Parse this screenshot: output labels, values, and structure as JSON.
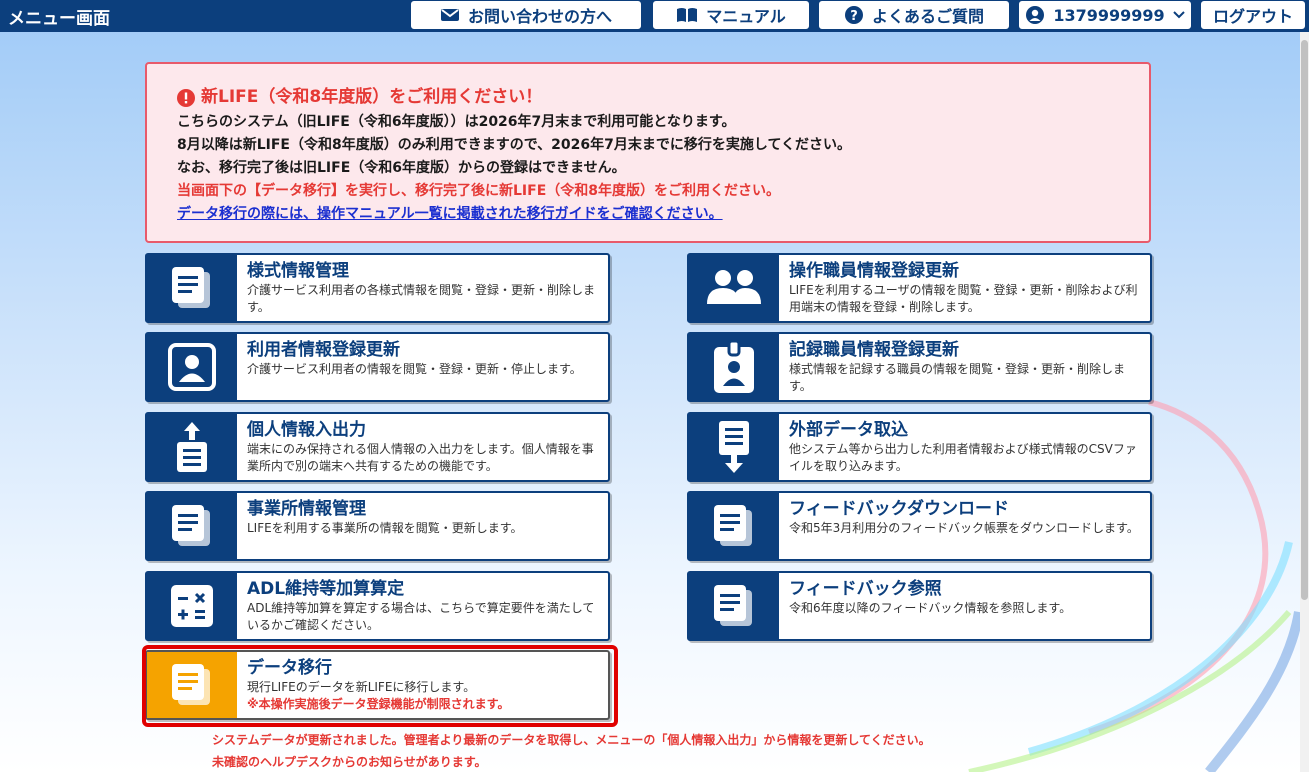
{
  "header": {
    "title": "メニュー画面",
    "contact": "お問い合わせの方へ",
    "manual": "マニュアル",
    "faq": "よくあるご質問",
    "user": "1379999999",
    "logout": "ログアウト"
  },
  "notice": {
    "title": "新LIFE（令和8年度版）をご利用ください！",
    "line1": "こちらのシステム（旧LIFE（令和6年度版））は2026年7月末まで利用可能となります。",
    "line2": "8月以降は新LIFE（令和8年度版）のみ利用できますので、2026年7月末までに移行を実施してください。",
    "line3": "なお、移行完了後は旧LIFE（令和6年度版）からの登録はできません。",
    "line4": "当画面下の【データ移行】を実行し、移行完了後に新LIFE（令和8年度版）をご利用ください。",
    "link": "データ移行の際には、操作マニュアル一覧に掲載された移行ガイドをご確認ください。"
  },
  "menu": {
    "form_info": {
      "title": "様式情報管理",
      "desc": "介護サービス利用者の各様式情報を閲覧・登録・更新・削除します。"
    },
    "operator": {
      "title": "操作職員情報登録更新",
      "desc": "LIFEを利用するユーザの情報を閲覧・登録・更新・削除および利用端末の情報を登録・削除します。"
    },
    "user_info": {
      "title": "利用者情報登録更新",
      "desc": "介護サービス利用者の情報を閲覧・登録・更新・停止します。"
    },
    "recorder": {
      "title": "記録職員情報登録更新",
      "desc": "様式情報を記録する職員の情報を閲覧・登録・更新・削除します。"
    },
    "personal_io": {
      "title": "個人情報入出力",
      "desc": "端末にのみ保持される個人情報の入出力をします。個人情報を事業所内で別の端末へ共有するための機能です。"
    },
    "external": {
      "title": "外部データ取込",
      "desc": "他システム等から出力した利用者情報および様式情報のCSVファイルを取り込みます。"
    },
    "office": {
      "title": "事業所情報管理",
      "desc": "LIFEを利用する事業所の情報を閲覧・更新します。"
    },
    "fb_download": {
      "title": "フィードバックダウンロード",
      "desc": "令和5年3月利用分のフィードバック帳票をダウンロードします。"
    },
    "adl": {
      "title": "ADL維持等加算算定",
      "desc": "ADL維持等加算を算定する場合は、こちらで算定要件を満たしているかご確認ください。"
    },
    "fb_view": {
      "title": "フィードバック参照",
      "desc": "令和6年度以降のフィードバック情報を参照します。"
    },
    "migrate": {
      "title": "データ移行",
      "desc": "現行LIFEのデータを新LIFEに移行します。",
      "warn": "※本操作実施後データ登録機能が制限されます。"
    }
  },
  "messages": {
    "update": "システムデータが更新されました。管理者より最新のデータを取得し、メニューの「個人情報入出力」から情報を更新してください。",
    "helpdesk": "未確認のヘルプデスクからのお知らせがあります。"
  },
  "colors": {
    "navy": "#0c3f7d",
    "alert_red": "#e53935",
    "migrate_orange": "#f5a300"
  }
}
